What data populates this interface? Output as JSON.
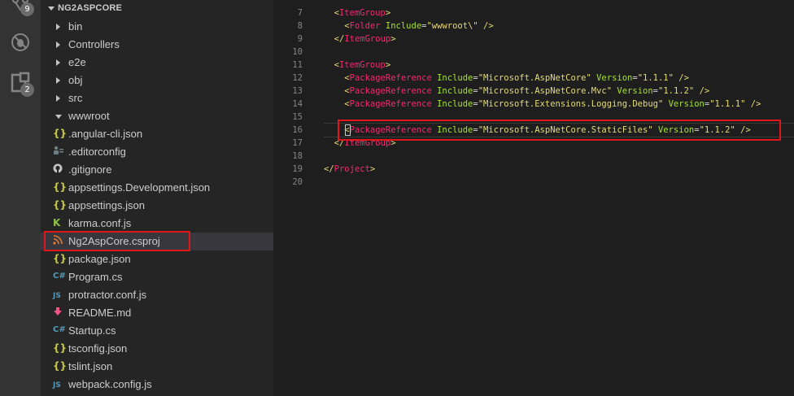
{
  "activity_bar": {
    "scm_badge": "9",
    "extensions_badge": "2"
  },
  "explorer": {
    "section_title": "NG2ASPCORE",
    "items": [
      {
        "label": "bin",
        "kind": "folder"
      },
      {
        "label": "Controllers",
        "kind": "folder"
      },
      {
        "label": "e2e",
        "kind": "folder"
      },
      {
        "label": "obj",
        "kind": "folder"
      },
      {
        "label": "src",
        "kind": "folder"
      },
      {
        "label": "wwwroot",
        "kind": "folder-open"
      },
      {
        "label": ".angular-cli.json",
        "kind": "json"
      },
      {
        "label": ".editorconfig",
        "kind": "editorconfig"
      },
      {
        "label": ".gitignore",
        "kind": "git"
      },
      {
        "label": "appsettings.Development.json",
        "kind": "json"
      },
      {
        "label": "appsettings.json",
        "kind": "json"
      },
      {
        "label": "karma.conf.js",
        "kind": "karma"
      },
      {
        "label": "Ng2AspCore.csproj",
        "kind": "rss"
      },
      {
        "label": "package.json",
        "kind": "json"
      },
      {
        "label": "Program.cs",
        "kind": "csharp"
      },
      {
        "label": "protractor.conf.js",
        "kind": "js"
      },
      {
        "label": "README.md",
        "kind": "markdown"
      },
      {
        "label": "Startup.cs",
        "kind": "csharp"
      },
      {
        "label": "tsconfig.json",
        "kind": "json"
      },
      {
        "label": "tslint.json",
        "kind": "json"
      },
      {
        "label": "webpack.config.js",
        "kind": "js"
      }
    ]
  },
  "icons": {
    "json": "{}",
    "js": "JS",
    "csharp": "C#",
    "karma": "K"
  },
  "editor": {
    "lines": [
      {
        "n": "7",
        "indent": "  ",
        "parts": [
          [
            "br",
            "<"
          ],
          [
            "tag",
            "ItemGroup"
          ],
          [
            "br",
            ">"
          ]
        ]
      },
      {
        "n": "8",
        "indent": "    ",
        "parts": [
          [
            "br",
            "<"
          ],
          [
            "tag",
            "Folder"
          ],
          [
            "punct",
            " "
          ],
          [
            "attr",
            "Include"
          ],
          [
            "punct",
            "="
          ],
          [
            "str",
            "\"wwwroot\\\""
          ],
          [
            "punct",
            " "
          ],
          [
            "br",
            "/>"
          ]
        ]
      },
      {
        "n": "9",
        "indent": "  ",
        "parts": [
          [
            "br",
            "</"
          ],
          [
            "tag",
            "ItemGroup"
          ],
          [
            "br",
            ">"
          ]
        ]
      },
      {
        "n": "10",
        "indent": "",
        "parts": []
      },
      {
        "n": "11",
        "indent": "  ",
        "parts": [
          [
            "br",
            "<"
          ],
          [
            "tag",
            "ItemGroup"
          ],
          [
            "br",
            ">"
          ]
        ]
      },
      {
        "n": "12",
        "indent": "    ",
        "parts": [
          [
            "br",
            "<"
          ],
          [
            "tag",
            "PackageReference"
          ],
          [
            "punct",
            " "
          ],
          [
            "attr",
            "Include"
          ],
          [
            "punct",
            "="
          ],
          [
            "str",
            "\"Microsoft.AspNetCore\""
          ],
          [
            "punct",
            " "
          ],
          [
            "attr",
            "Version"
          ],
          [
            "punct",
            "="
          ],
          [
            "str",
            "\"1.1.1\""
          ],
          [
            "punct",
            " "
          ],
          [
            "br",
            "/>"
          ]
        ]
      },
      {
        "n": "13",
        "indent": "    ",
        "parts": [
          [
            "br",
            "<"
          ],
          [
            "tag",
            "PackageReference"
          ],
          [
            "punct",
            " "
          ],
          [
            "attr",
            "Include"
          ],
          [
            "punct",
            "="
          ],
          [
            "str",
            "\"Microsoft.AspNetCore.Mvc\""
          ],
          [
            "punct",
            " "
          ],
          [
            "attr",
            "Version"
          ],
          [
            "punct",
            "="
          ],
          [
            "str",
            "\"1.1.2\""
          ],
          [
            "punct",
            " "
          ],
          [
            "br",
            "/>"
          ]
        ]
      },
      {
        "n": "14",
        "indent": "    ",
        "parts": [
          [
            "br",
            "<"
          ],
          [
            "tag",
            "PackageReference"
          ],
          [
            "punct",
            " "
          ],
          [
            "attr",
            "Include"
          ],
          [
            "punct",
            "="
          ],
          [
            "str",
            "\"Microsoft.Extensions.Logging.Debug\""
          ],
          [
            "punct",
            " "
          ],
          [
            "attr",
            "Version"
          ],
          [
            "punct",
            "="
          ],
          [
            "str",
            "\"1.1.1\""
          ],
          [
            "punct",
            " "
          ],
          [
            "br",
            "/>"
          ]
        ]
      },
      {
        "n": "15",
        "indent": "",
        "parts": []
      },
      {
        "n": "16",
        "indent": "    ",
        "parts": [
          [
            "br",
            "<"
          ],
          [
            "tag",
            "PackageReference"
          ],
          [
            "punct",
            " "
          ],
          [
            "attr",
            "Include"
          ],
          [
            "punct",
            "="
          ],
          [
            "str",
            "\"Microsoft.AspNetCore.StaticFiles\""
          ],
          [
            "punct",
            " "
          ],
          [
            "attr",
            "Version"
          ],
          [
            "punct",
            "="
          ],
          [
            "str",
            "\"1.1.2\""
          ],
          [
            "punct",
            " "
          ],
          [
            "br",
            "/>"
          ]
        ]
      },
      {
        "n": "17",
        "indent": "  ",
        "parts": [
          [
            "br",
            "</"
          ],
          [
            "tag",
            "ItemGroup"
          ],
          [
            "br",
            ">"
          ]
        ]
      },
      {
        "n": "18",
        "indent": "",
        "parts": []
      },
      {
        "n": "19",
        "indent": "",
        "parts": [
          [
            "br",
            "</"
          ],
          [
            "tag",
            "Project"
          ],
          [
            "br",
            ">"
          ]
        ]
      },
      {
        "n": "20",
        "indent": "",
        "parts": []
      }
    ]
  },
  "colors": {
    "highlight_border": "#e0161b",
    "json_icon": "#cbcb41",
    "js_icon": "#519aba",
    "csharp_icon": "#519aba",
    "karma_icon": "#8dc149",
    "rss_icon": "#e37933",
    "markdown_icon": "#f55385"
  }
}
